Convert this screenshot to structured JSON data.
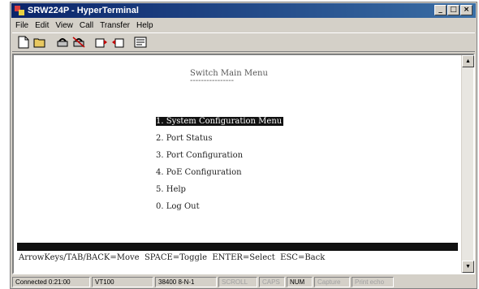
{
  "window": {
    "title": "SRW224P - HyperTerminal"
  },
  "menubar": {
    "items": [
      "File",
      "Edit",
      "View",
      "Call",
      "Transfer",
      "Help"
    ]
  },
  "toolbar": {
    "buttons": [
      "new-icon",
      "open-icon",
      "connect-icon",
      "disconnect-icon",
      "send-icon",
      "receive-icon",
      "properties-icon"
    ]
  },
  "terminal": {
    "title": "Switch Main Menu",
    "title_underline": "----------------",
    "menu": [
      {
        "key": "1",
        "label": "System Configuration Menu",
        "selected": true
      },
      {
        "key": "2",
        "label": "Port Status",
        "selected": false
      },
      {
        "key": "3",
        "label": "Port Configuration",
        "selected": false
      },
      {
        "key": "4",
        "label": "PoE Configuration",
        "selected": false
      },
      {
        "key": "5",
        "label": "Help",
        "selected": false
      },
      {
        "key": "0",
        "label": "Log Out",
        "selected": false
      }
    ],
    "menu_lines": [
      "1. System Configuration Menu",
      "2. Port Status",
      "3. Port Configuration",
      "4. PoE Configuration",
      "5. Help",
      "0. Log Out"
    ],
    "help_line": "ArrowKeys/TAB/BACK=Move  SPACE=Toggle  ENTER=Select  ESC=Back"
  },
  "statusbar": {
    "connected": "Connected 0:21:00",
    "emulation": "VT100",
    "settings": "38400 8-N-1",
    "scroll": "SCROLL",
    "caps": "CAPS",
    "num": "NUM",
    "capture": "Capture",
    "print_echo": "Print echo"
  }
}
